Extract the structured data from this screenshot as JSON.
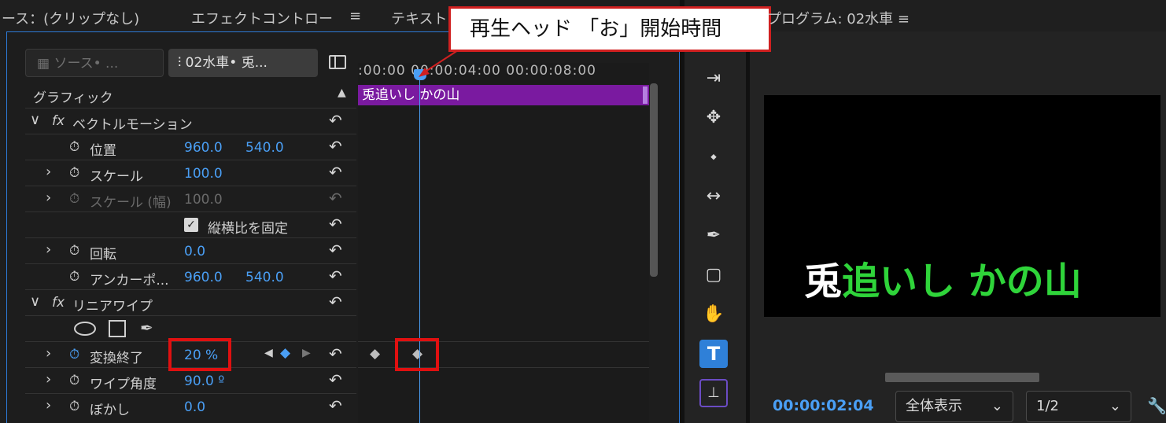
{
  "tabs": {
    "source": "ース：(クリップなし)",
    "effect_controls": "エフェクトコントロー",
    "text": "テキスト",
    "menu_glyph": "≡"
  },
  "callout": "再生ヘッド 「お」開始時間",
  "header": {
    "source_tab": "ソース• ...",
    "sequence_tab": "02水車• 兎..."
  },
  "ruler": ":00:00 00:00:04:00 00:00:08:00",
  "clip_name": "兎追いし かの山",
  "sections": {
    "graphic": "グラフィック",
    "vector_motion": "ベクトルモーション",
    "linear_wipe": "リニアワイプ",
    "fx": "fx"
  },
  "properties": {
    "position": {
      "label": "位置",
      "x": "960.0",
      "y": "540.0"
    },
    "scale": {
      "label": "スケール",
      "value": "100.0"
    },
    "scale_width": {
      "label": "スケール (幅)",
      "value": "100.0"
    },
    "uniform_scale": {
      "label": "縦横比を固定",
      "checked": true
    },
    "rotation": {
      "label": "回転",
      "value": "0.0"
    },
    "anchor": {
      "label": "アンカーポ...",
      "x": "960.0",
      "y": "540.0"
    },
    "transition_completion": {
      "label": "変換終了",
      "value": "20 %"
    },
    "wipe_angle": {
      "label": "ワイプ角度",
      "value": "90.0 º"
    },
    "feather": {
      "label": "ぼかし",
      "value": "0.0"
    }
  },
  "program": {
    "title": "プログラム: 02水車",
    "caption_white": "兎",
    "caption_green": "追いし かの山",
    "timecode": "00:00:02:04",
    "zoom": "全体表示",
    "resolution": "1/2"
  },
  "colors": {
    "accent": "#4a9ff5",
    "clip": "#7a1aa0",
    "highlight": "#e01010",
    "caption_green": "#2fd43a"
  }
}
